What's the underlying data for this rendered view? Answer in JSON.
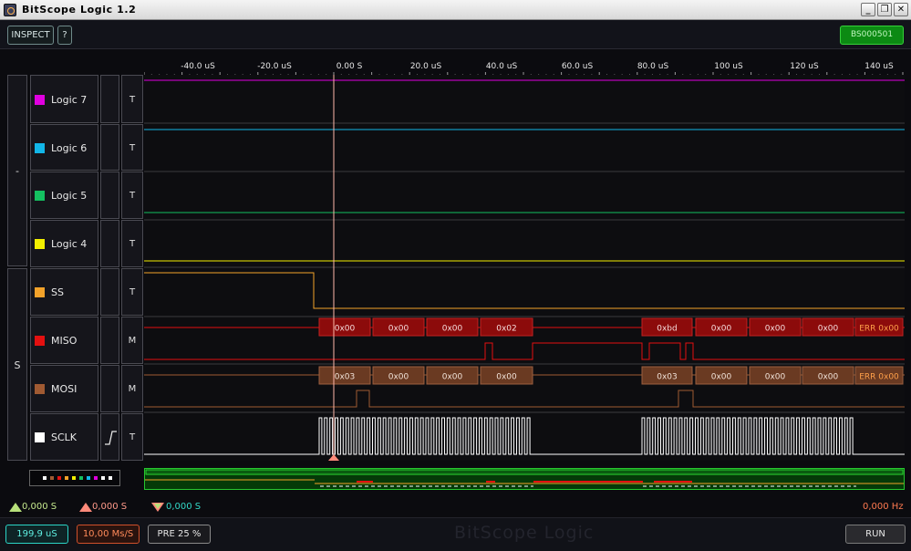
{
  "window": {
    "title": "BitScope Logic 1.2",
    "buttons": [
      "_",
      "❐",
      "✕"
    ]
  },
  "toolbar": {
    "inspect": "INSPECT",
    "help": "?",
    "serial": "BS000501"
  },
  "ruler": {
    "ticks": [
      "-40.0 uS",
      "-20.0 uS",
      "0.00  S",
      "20.0 uS",
      "40.0 uS",
      "60.0 uS",
      "80.0 uS",
      "100 uS",
      "120 uS",
      "140 uS"
    ]
  },
  "groups": [
    {
      "label": "-"
    },
    {
      "label": "S"
    }
  ],
  "channels": [
    {
      "name": "Logic 7",
      "color": "#e000e0",
      "mode": "T"
    },
    {
      "name": "Logic 6",
      "color": "#12b6e8",
      "mode": "T"
    },
    {
      "name": "Logic 5",
      "color": "#14c060",
      "mode": "T"
    },
    {
      "name": "Logic 4",
      "color": "#f2ef00",
      "mode": "T"
    },
    {
      "name": "SS",
      "color": "#f2a22a",
      "mode": "T"
    },
    {
      "name": "MISO",
      "color": "#e41010",
      "mode": "M"
    },
    {
      "name": "MOSI",
      "color": "#a05a32",
      "mode": "M"
    },
    {
      "name": "SCLK",
      "color": "#ffffff",
      "mode": "T"
    }
  ],
  "decode": {
    "miso": [
      "0x00",
      "0x00",
      "0x00",
      "0x02",
      "0xbd",
      "0x00",
      "0x00",
      "0x00",
      "ERR 0x00"
    ],
    "mosi": [
      "0x03",
      "0x00",
      "0x00",
      "0x00",
      "0x03",
      "0x00",
      "0x00",
      "0x00",
      "ERR 0x00"
    ]
  },
  "status": {
    "green_readout": "0,000  S",
    "red_readout": "0,000  S",
    "delta_readout": "0,000  S",
    "frequency": "0,000  Hz"
  },
  "bottom": {
    "duration": "199,9 uS",
    "rate": "10,00 Ms/S",
    "pretrigger": "PRE 25 %",
    "watermark": "BitScope Logic",
    "run": "RUN"
  },
  "colors": {
    "cursor": "#ff8a7a",
    "cyan": "#2bd4c6",
    "accent_green": "#0c8a13"
  }
}
